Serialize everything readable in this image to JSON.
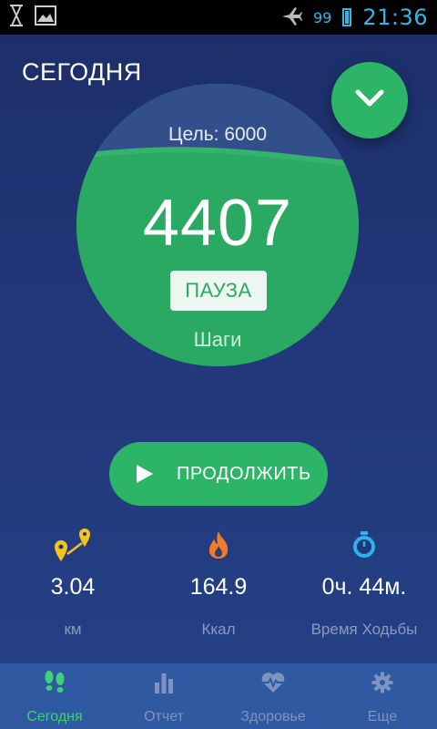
{
  "status_bar": {
    "battery_level": "99",
    "time": "21:36",
    "icons": [
      "hourglass-icon",
      "image-icon",
      "airplane-mode-icon",
      "battery-icon"
    ]
  },
  "header": {
    "title": "СЕГОДНЯ"
  },
  "steps": {
    "goal_text": "Цель: 6000",
    "count": "4407",
    "pause_label": "ПАУЗА",
    "unit_label": "Шаги",
    "progress_fraction": 0.7345
  },
  "continue_label": "ПРОДОЛЖИТЬ",
  "stats": [
    {
      "icon": "distance-pins-icon",
      "value": "3.04",
      "unit": "км"
    },
    {
      "icon": "flame-icon",
      "value": "164.9",
      "unit": "Ккал"
    },
    {
      "icon": "stopwatch-icon",
      "value": "0ч. 44м.",
      "unit": "Время Ходьбы"
    }
  ],
  "nav": [
    {
      "icon": "footsteps-icon",
      "label": "Сегодня",
      "active": true
    },
    {
      "icon": "bar-chart-icon",
      "label": "Отчет",
      "active": false
    },
    {
      "icon": "heartbeat-icon",
      "label": "Здоровье",
      "active": false
    },
    {
      "icon": "gear-icon",
      "label": "Еще",
      "active": false
    }
  ],
  "colors": {
    "accent_green": "#2db567",
    "active_nav": "#3fd07a",
    "status_blue": "#33b5e5",
    "nav_background": "#2f5aa1"
  }
}
